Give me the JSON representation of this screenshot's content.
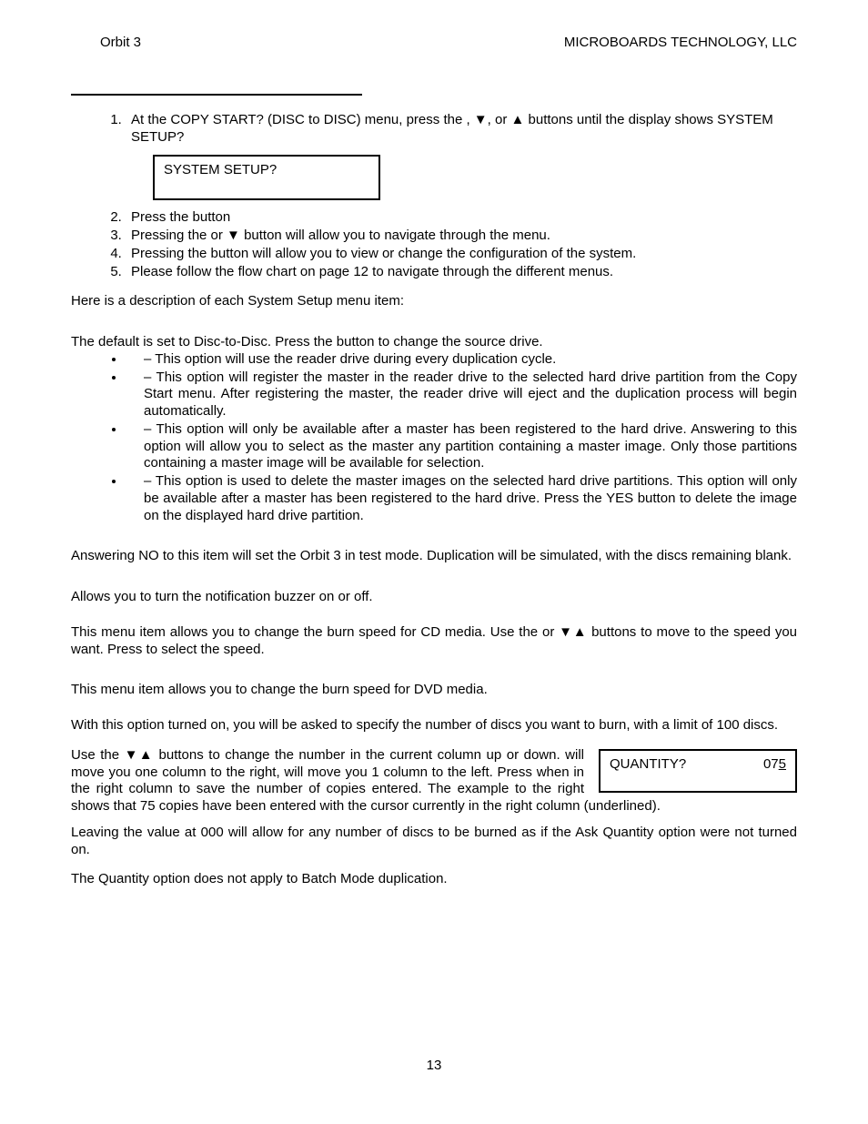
{
  "header": {
    "left": "Orbit 3",
    "right": "MICROBOARDS TECHNOLOGY, LLC"
  },
  "steps": {
    "s1a": "At the COPY START? (DISC to DISC) menu, press the ",
    "s1b": " , ▼, or ▲ buttons until the display shows SYSTEM SETUP?",
    "lcd": "SYSTEM SETUP?",
    "s2a": "Press the ",
    "s2b": " button",
    "s3a": "Pressing the ",
    "s3b": " or ▼ button will allow you to navigate through the menu.",
    "s4a": "Pressing the ",
    "s4b": " button will allow you to view or change the configuration of the system.",
    "s5": "Please follow the flow chart on page 12 to navigate through the different menus."
  },
  "desc": "Here is a description of each System Setup menu item:",
  "default_line_a": "The default is set to Disc-to-Disc.  Press the ",
  "default_line_b": " button to change the source drive.",
  "bullets": {
    "b1": " – This option will use the reader drive during every duplication cycle.",
    "b2": " – This option will register the master in the reader drive to the selected hard drive partition from the Copy Start menu.  After registering the master, the reader drive will eject and the duplication process will begin automatically.",
    "b3a": " – This option will only be available after a master has been registered to the hard drive.  Answering ",
    "b3b": " to this option will allow you to select as the master any partition containing a master image.  Only those partitions containing a master image will be available for selection.",
    "b4": " – This option is used to delete the master images on the selected hard drive partitions.  This option will only be available after a master has been registered to the hard drive.  Press the YES button to delete the image on the displayed hard drive partition."
  },
  "test_mode": "Answering NO to this item will set the Orbit 3 in test mode.  Duplication will be simulated, with the discs remaining  blank.",
  "buzzer": "Allows you to turn the notification buzzer on or off.",
  "cd_speed_a": "This menu item allows you to change the burn speed for CD media.  Use the ",
  "cd_speed_b": " or ▼▲ buttons to move to the speed you want.  Press ",
  "cd_speed_c": " to select the speed.",
  "dvd_speed": "This menu item allows you to change the burn speed for DVD media.",
  "qty_intro": "With this option turned on, you will be asked to specify the number of discs you want to burn, with a limit of 100 discs.",
  "qty_change_a": "Use the ▼▲ buttons to change the number in the current column up or down. ",
  "qty_change_b": " will move you one column to the right, ",
  "qty_change_c": " will move you 1 column to the left.  Press ",
  "qty_change_d": " when in the right column to save the number of copies entered.  The example to the right shows that 75 copies have been entered with the cursor currently in the right column (underlined).",
  "qty_box_label": "QUANTITY?",
  "qty_box_val_pre": "07",
  "qty_box_val_last": "5",
  "qty_zero": "Leaving the value at 000 will allow for any number of discs to be burned as if the Ask Quantity option were not turned on.",
  "qty_batch": "The Quantity option does not apply to Batch Mode duplication.",
  "page_num": "13"
}
